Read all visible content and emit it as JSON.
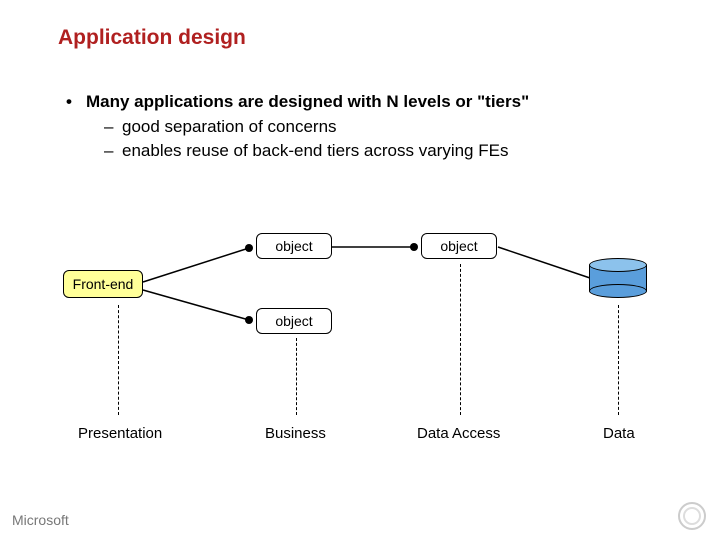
{
  "title": "Application design",
  "bullets": {
    "main": "Many applications are designed with N levels or \"tiers\"",
    "sub1": "good separation of concerns",
    "sub2": "enables reuse of back-end tiers across varying FEs"
  },
  "nodes": {
    "frontend": "Front-end",
    "obj1": "object",
    "obj2": "object",
    "obj3": "object"
  },
  "tiers": {
    "t1": "Presentation",
    "t2": "Business",
    "t3": "Data Access",
    "t4": "Data"
  },
  "footer": "Microsoft"
}
